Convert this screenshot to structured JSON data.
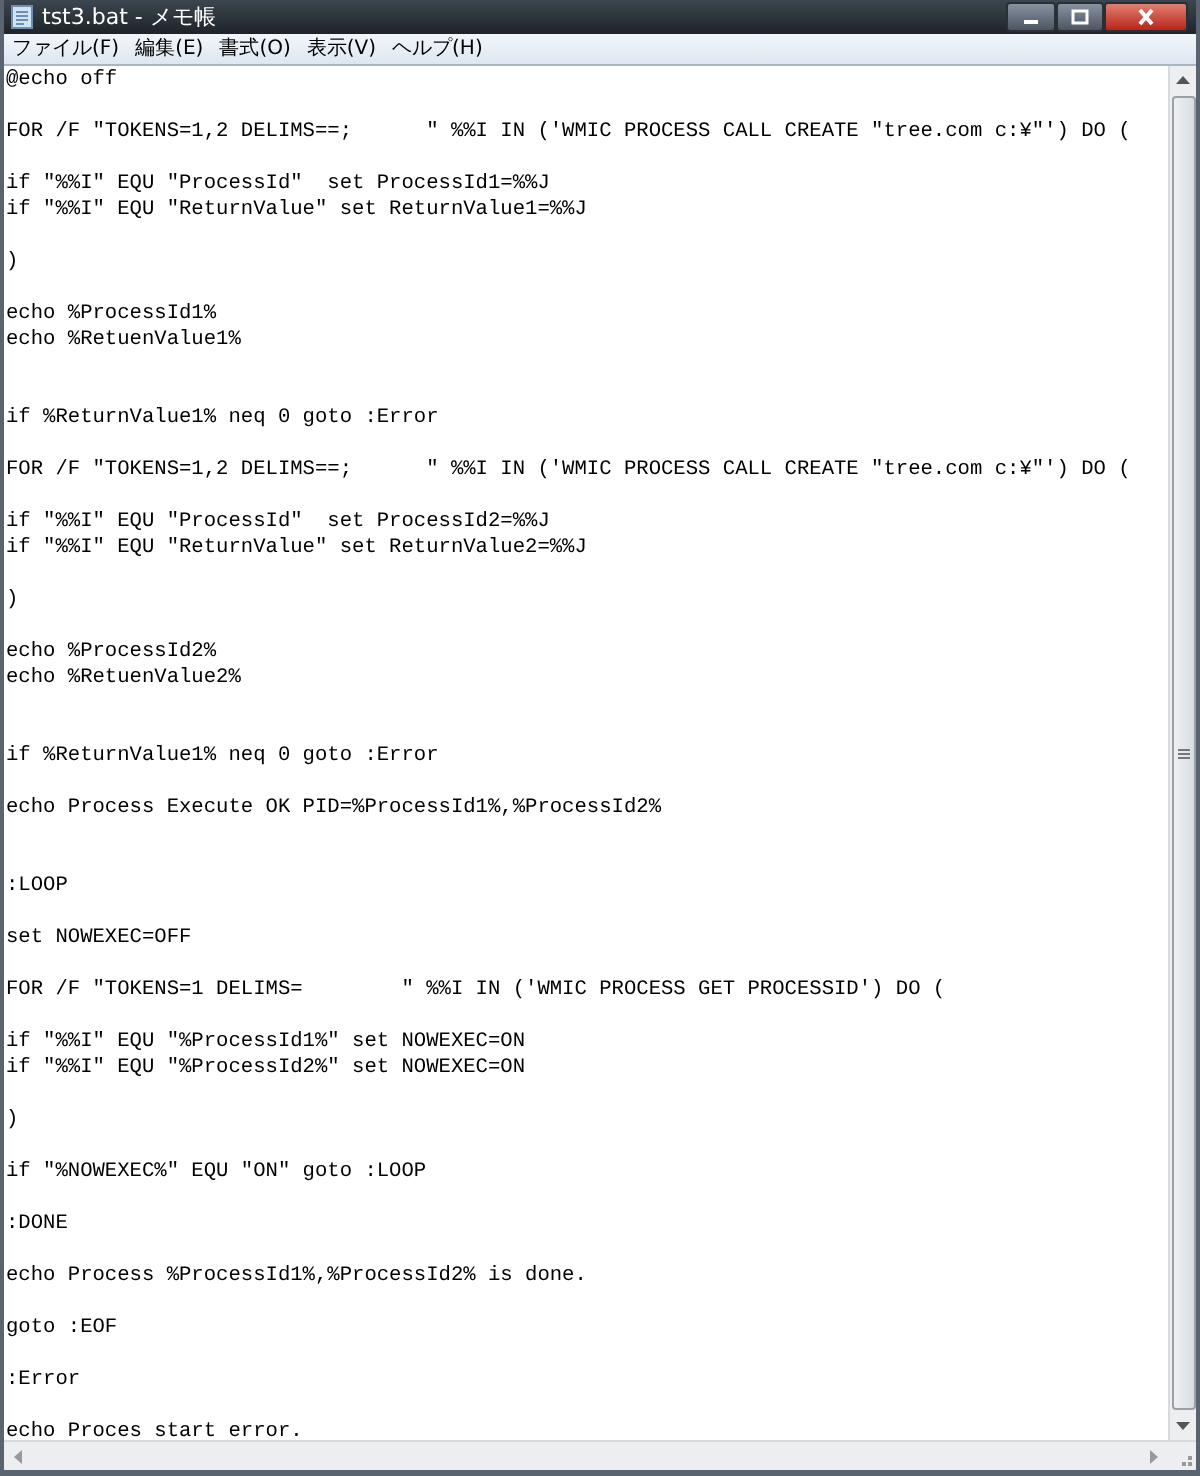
{
  "window": {
    "title": "tst3.bat - メモ帳"
  },
  "menu": [
    "ファイル(F)",
    "編集(E)",
    "書式(O)",
    "表示(V)",
    "ヘルプ(H)"
  ],
  "editor": {
    "content": "@echo off\n\nFOR /F \"TOKENS=1,2 DELIMS==;      \" %%I IN ('WMIC PROCESS CALL CREATE \"tree.com c:¥\"') DO (\n\nif \"%%I\" EQU \"ProcessId\"  set ProcessId1=%%J\nif \"%%I\" EQU \"ReturnValue\" set ReturnValue1=%%J\n\n)\n\necho %ProcessId1%\necho %RetuenValue1%\n\n\nif %ReturnValue1% neq 0 goto :Error\n\nFOR /F \"TOKENS=1,2 DELIMS==;      \" %%I IN ('WMIC PROCESS CALL CREATE \"tree.com c:¥\"') DO (\n\nif \"%%I\" EQU \"ProcessId\"  set ProcessId2=%%J\nif \"%%I\" EQU \"ReturnValue\" set ReturnValue2=%%J\n\n)\n\necho %ProcessId2%\necho %RetuenValue2%\n\n\nif %ReturnValue1% neq 0 goto :Error\n\necho Process Execute OK PID=%ProcessId1%,%ProcessId2%\n\n\n:LOOP\n\nset NOWEXEC=OFF\n\nFOR /F \"TOKENS=1 DELIMS=        \" %%I IN ('WMIC PROCESS GET PROCESSID') DO (\n\nif \"%%I\" EQU \"%ProcessId1%\" set NOWEXEC=ON\nif \"%%I\" EQU \"%ProcessId2%\" set NOWEXEC=ON\n\n)\n\nif \"%NOWEXEC%\" EQU \"ON\" goto :LOOP\n\n:DONE\n\necho Process %ProcessId1%,%ProcessId2% is done.\n\ngoto :EOF\n\n:Error\n\necho Proces start error."
  }
}
